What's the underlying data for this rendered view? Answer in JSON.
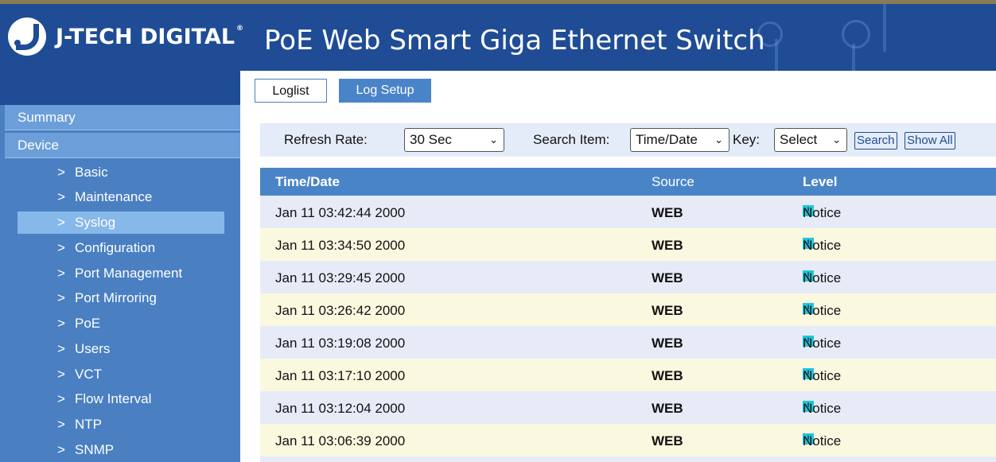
{
  "brand": {
    "name": "J-TECH DIGITAL",
    "reg": "®"
  },
  "header": {
    "title": "PoE Web Smart Giga Ethernet Switch"
  },
  "sidebar": {
    "sections": [
      {
        "label": "Summary"
      },
      {
        "label": "Device"
      }
    ],
    "items": [
      {
        "label": "Basic"
      },
      {
        "label": "Maintenance"
      },
      {
        "label": "Syslog"
      },
      {
        "label": "Configuration"
      },
      {
        "label": "Port Management"
      },
      {
        "label": "Port Mirroring"
      },
      {
        "label": "PoE"
      },
      {
        "label": "Users"
      },
      {
        "label": "VCT"
      },
      {
        "label": "Flow Interval"
      },
      {
        "label": "NTP"
      },
      {
        "label": "SNMP"
      }
    ],
    "active": "Syslog",
    "arrow": ">"
  },
  "tabs": [
    {
      "label": "Loglist"
    },
    {
      "label": "Log Setup"
    }
  ],
  "toolbar": {
    "refresh_label": "Refresh Rate:",
    "refresh_value": "30 Sec",
    "search_item_label": "Search Item:",
    "search_item_value": "Time/Date",
    "key_label": "Key:",
    "key_value": "Select",
    "search_button": "Search",
    "show_all_button": "Show All"
  },
  "table": {
    "headers": {
      "time": "Time/Date",
      "source": "Source",
      "level": "Level"
    },
    "rows": [
      {
        "time": "Jan 11 03:42:44 2000",
        "source": "WEB",
        "level": "Notice"
      },
      {
        "time": "Jan 11 03:34:50 2000",
        "source": "WEB",
        "level": "Notice"
      },
      {
        "time": "Jan 11 03:29:45 2000",
        "source": "WEB",
        "level": "Notice"
      },
      {
        "time": "Jan 11 03:26:42 2000",
        "source": "WEB",
        "level": "Notice"
      },
      {
        "time": "Jan 11 03:19:08 2000",
        "source": "WEB",
        "level": "Notice"
      },
      {
        "time": "Jan 11 03:17:10 2000",
        "source": "WEB",
        "level": "Notice"
      },
      {
        "time": "Jan 11 03:12:04 2000",
        "source": "WEB",
        "level": "Notice"
      },
      {
        "time": "Jan 11 03:06:39 2000",
        "source": "WEB",
        "level": "Notice"
      }
    ],
    "level_icon": "notice-icon",
    "level_icon_glyph": "!"
  },
  "colors": {
    "header": "#1f4c95",
    "sidebar": "#4a7fc2",
    "sidebar_active": "#86b8ea",
    "table_header": "#4a84c8",
    "row_odd": "#e6ebf7",
    "row_even": "#fbf8e0",
    "notice_badge": "#1fc6d8"
  }
}
